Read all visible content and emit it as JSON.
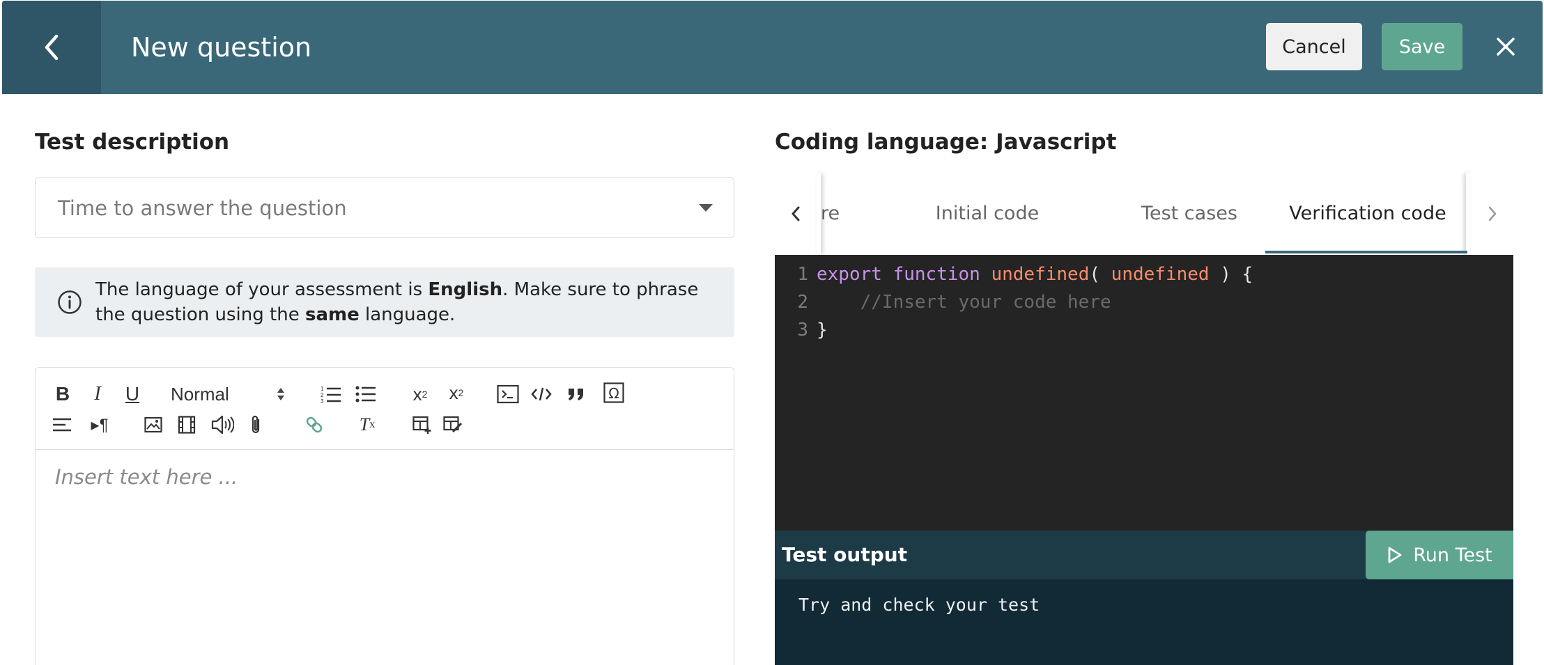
{
  "header": {
    "title": "New question",
    "cancel_label": "Cancel",
    "save_label": "Save",
    "back_icon": "chevron-left-icon",
    "close_icon": "close-icon"
  },
  "left": {
    "section_title": "Test description",
    "select": {
      "placeholder": "Time to answer the question"
    },
    "info": {
      "text_1": "The language of your assessment is ",
      "bold_1": "English",
      "text_2": ". Make sure to phrase the question using the ",
      "bold_2": "same",
      "text_3": " language."
    },
    "editor": {
      "format_value": "Normal",
      "placeholder": "Insert text here ..."
    }
  },
  "right": {
    "section_title": "Coding language: Javascript",
    "tabs": [
      {
        "label": "re"
      },
      {
        "label": "Initial code"
      },
      {
        "label": "Test cases"
      },
      {
        "label": "Verification code",
        "active": true
      }
    ],
    "code": {
      "line_numbers": [
        "1",
        "2",
        "3"
      ],
      "line1": {
        "kw_export": "export",
        "kw_function": "function",
        "name": "undefined",
        "paren_open": "(",
        "param": "undefined",
        "rest": " ) {"
      },
      "line2": "    //Insert your code here",
      "line3": "}"
    },
    "test_output_label": "Test output",
    "run_test_label": "Run Test",
    "output_text": "Try and check your test"
  },
  "colors": {
    "header_bg": "#3a6878",
    "accent_green": "#5ea690",
    "code_bg": "#242424",
    "output_bg": "#112a36"
  }
}
